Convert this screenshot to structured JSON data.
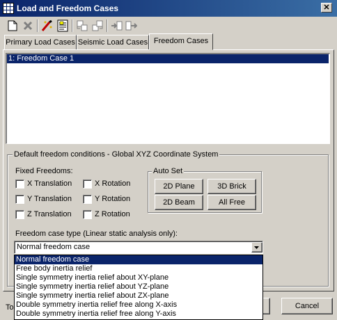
{
  "window": {
    "title": "Load and Freedom Cases",
    "close_glyph": "✕"
  },
  "toolbar": {
    "icons": [
      "new-icon",
      "delete-icon",
      "edit-icon",
      "properties-icon",
      "copy-from-icon",
      "copy-to-icon",
      "import-icon",
      "export-icon"
    ]
  },
  "tabs": [
    {
      "label": "Primary Load Cases",
      "active": false
    },
    {
      "label": "Seismic Load Cases",
      "active": false
    },
    {
      "label": "Freedom Cases",
      "active": true
    }
  ],
  "list": {
    "items": [
      "1: Freedom Case 1"
    ]
  },
  "freedom_group": {
    "title": "Default freedom conditions - Global XYZ Coordinate System",
    "fixed_label": "Fixed Freedoms:",
    "checkboxes": [
      {
        "label": "X Translation",
        "checked": false
      },
      {
        "label": "X Rotation",
        "checked": false
      },
      {
        "label": "Y Translation",
        "checked": false
      },
      {
        "label": "Y Rotation",
        "checked": false
      },
      {
        "label": "Z Translation",
        "checked": false
      },
      {
        "label": "Z Rotation",
        "checked": false
      }
    ],
    "autoset": {
      "title": "Auto Set",
      "buttons": [
        "2D Plane",
        "3D Brick",
        "2D Beam",
        "All Free"
      ]
    },
    "case_type_label": "Freedom case type (Linear static analysis only):",
    "case_type_value": "Normal freedom case",
    "options": [
      "Normal freedom case",
      "Free body inertia relief",
      "Single symmetry inertia relief about XY-plane",
      "Single symmetry inertia relief about YZ-plane",
      "Single symmetry inertia relief about ZX-plane",
      "Double symmetry inertia relief free along X-axis",
      "Double symmetry inertia relief free along Y-axis"
    ]
  },
  "footer": {
    "left_partial": "To",
    "cancel_label": "Cancel"
  }
}
